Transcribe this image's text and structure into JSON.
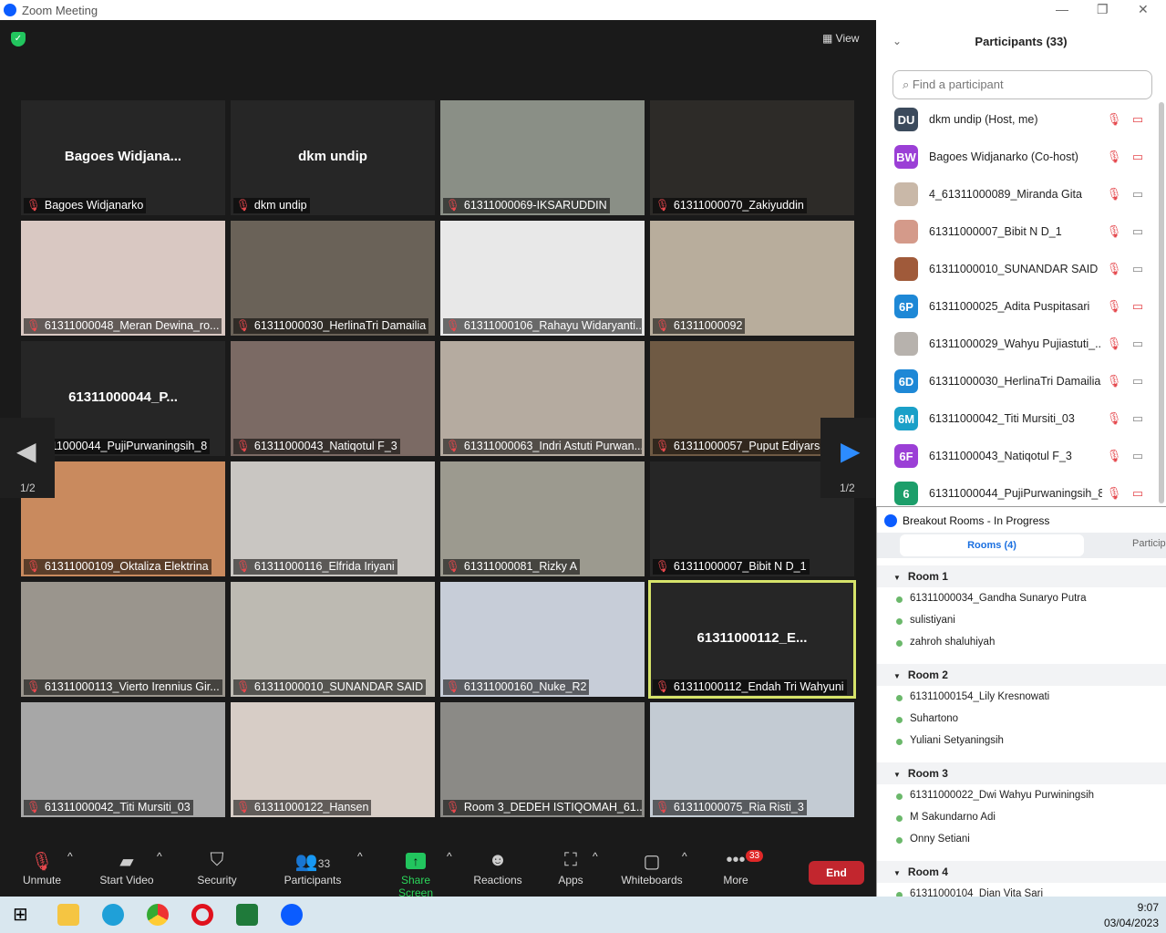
{
  "window": {
    "title": "Zoom Meeting"
  },
  "stage": {
    "view_label": "View",
    "page_left": "1/2",
    "page_right": "1/2"
  },
  "tiles": [
    {
      "name": "Bagoes Widjanarko",
      "big": "Bagoes  Widjana...",
      "bg": "#262626"
    },
    {
      "name": "dkm undip",
      "big": "dkm undip",
      "bg": "#262626"
    },
    {
      "name": "61311000069-IKSARUDDIN",
      "bg": "#8a8f86"
    },
    {
      "name": "61311000070_Zakiyuddin",
      "bg": "#2d2b28"
    },
    {
      "name": "61311000048_Meran Dewina_ro...",
      "bg": "#d9c8c2"
    },
    {
      "name": "61311000030_HerlinaTri Damailia",
      "bg": "#6a6258"
    },
    {
      "name": "61311000106_Rahayu Widaryanti...",
      "bg": "#e8e8e8"
    },
    {
      "name": "61311000092",
      "bg": "#b8ad9c"
    },
    {
      "name": "311000044_PujiPurwaningsih_8",
      "big": "61311000044_P...",
      "bg": "#262626"
    },
    {
      "name": "61311000043_Natiqotul F_3",
      "bg": "#7b6a64"
    },
    {
      "name": "61311000063_Indri Astuti Purwan...",
      "bg": "#b5aba0"
    },
    {
      "name": "61311000057_Puput Ediyarsa",
      "bg": "#6f5a44"
    },
    {
      "name": "61311000109_Oktaliza Elektrina",
      "bg": "#c98a5e"
    },
    {
      "name": "61311000116_Elfrida Iriyani",
      "bg": "#c9c6c2"
    },
    {
      "name": "61311000081_Rizky A",
      "bg": "#9c9a8f"
    },
    {
      "name": "61311000007_Bibit N D_1",
      "bg": "#262626"
    },
    {
      "name": "61311000113_Vierto Irennius Gir...",
      "bg": "#9a958d"
    },
    {
      "name": "61311000010_SUNANDAR SAID",
      "bg": "#bdbab2"
    },
    {
      "name": "61311000160_Nuke_R2",
      "bg": "#c7cdd8"
    },
    {
      "name": "61311000112_Endah Tri Wahyuni",
      "big": "61311000112_E...",
      "bg": "#262626",
      "active": true
    },
    {
      "name": "61311000042_Titi Mursiti_03",
      "bg": "#a7a7a7"
    },
    {
      "name": "61311000122_Hansen",
      "bg": "#d7cdc6"
    },
    {
      "name": "Room 3_DEDEH ISTIQOMAH_61...",
      "bg": "#8b8a86"
    },
    {
      "name": "61311000075_Ria Risti_3",
      "bg": "#c3cbd3"
    }
  ],
  "toolbar": {
    "unmute": "Unmute",
    "start_video": "Start Video",
    "security": "Security",
    "participants": "Participants",
    "participants_count": "33",
    "share_screen": "Share Screen",
    "reactions": "Reactions",
    "apps": "Apps",
    "whiteboards": "Whiteboards",
    "more": "More",
    "more_badge": "33",
    "end": "End"
  },
  "participants_panel": {
    "title": "Participants (33)",
    "search_placeholder": "Find a participant",
    "items": [
      {
        "initials": "DU",
        "color": "#3b4a5c",
        "name": "dkm undip (Host, me)",
        "video_off": true
      },
      {
        "initials": "BW",
        "color": "#9b3fd6",
        "name": "Bagoes Widjanarko (Co-host)",
        "video_off": true
      },
      {
        "initials": "",
        "color": "#c9b8a8",
        "name": "4_61311000089_Miranda Gita",
        "video_off": false
      },
      {
        "initials": "",
        "color": "#d49a8a",
        "name": "61311000007_Bibit N D_1",
        "video_off": false
      },
      {
        "initials": "",
        "color": "#a05a3a",
        "name": "61311000010_SUNANDAR SAID",
        "video_off": false
      },
      {
        "initials": "6P",
        "color": "#1e88d6",
        "name": "61311000025_Adita Puspitasari",
        "video_off": true
      },
      {
        "initials": "",
        "color": "#b7b2ad",
        "name": "61311000029_Wahyu Pujiastuti_...",
        "video_off": false
      },
      {
        "initials": "6D",
        "color": "#1e88d6",
        "name": "61311000030_HerlinaTri Damailia",
        "video_off": false
      },
      {
        "initials": "6M",
        "color": "#1aa0c8",
        "name": "61311000042_Titi Mursiti_03",
        "video_off": false
      },
      {
        "initials": "6F",
        "color": "#9b3fd6",
        "name": "61311000043_Natiqotul F_3",
        "video_off": false
      },
      {
        "initials": "6",
        "color": "#1c9e6a",
        "name": "61311000044_PujiPurwaningsih_8",
        "video_off": true
      }
    ]
  },
  "breakout": {
    "title": "Breakout Rooms - In Progress",
    "tab_rooms": "Rooms (4)",
    "tab_participants": "Particip",
    "rooms": [
      {
        "name": "Room 1",
        "members": [
          "61311000034_Gandha Sunaryo Putra",
          "sulistiyani",
          "zahroh shaluhiyah"
        ]
      },
      {
        "name": "Room 2",
        "members": [
          "61311000154_Lily Kresnowati",
          "Suhartono",
          "Yuliani Setyaningsih"
        ]
      },
      {
        "name": "Room 3",
        "members": [
          "61311000022_Dwi Wahyu Purwiningsih",
          "M Sakundarno Adi",
          "Onny Setiani"
        ]
      },
      {
        "name": "Room 4",
        "members": [
          "61311000104_Dian Vita Sari"
        ]
      }
    ]
  },
  "taskbar": {
    "time": "9:07",
    "date": "03/04/2023"
  }
}
